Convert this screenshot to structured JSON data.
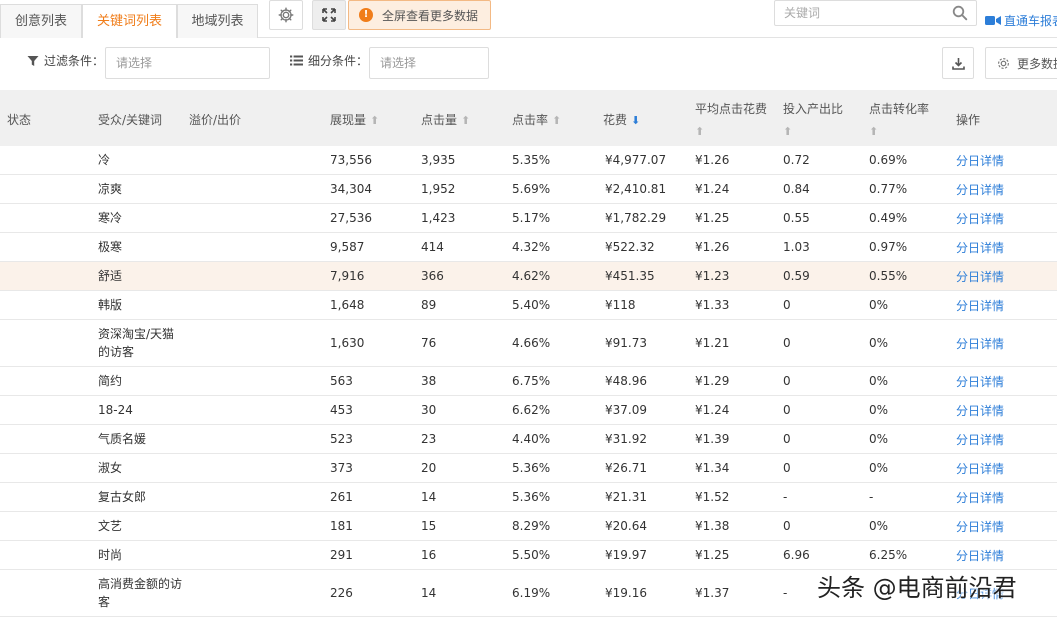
{
  "tabs": [
    {
      "label": "创意列表",
      "active": false
    },
    {
      "label": "关键词列表",
      "active": true
    },
    {
      "label": "地域列表",
      "active": false
    }
  ],
  "toolbar": {
    "settings_icon": "gear-icon",
    "fullscreen_icon": "expand-icon",
    "notice_label": "全屏查看更多数据",
    "search_placeholder": "关键词",
    "report_link": "直通车报表"
  },
  "filters": {
    "filter_label": "过滤条件：",
    "filter_placeholder": "请选择",
    "sub_label": "细分条件：",
    "sub_placeholder": "请选择",
    "more_label": "更多数据"
  },
  "table": {
    "headers": {
      "status": "状态",
      "keyword": "受众/关键词",
      "bid": "溢价/出价",
      "impressions": "展现量",
      "clicks": "点击量",
      "ctr": "点击率",
      "cost": "花费",
      "cpc": "平均点击花费",
      "roi": "投入产出比",
      "cvr": "点击转化率",
      "action": "操作"
    },
    "sorted_column": "花费",
    "rows": [
      {
        "keyword": "冷",
        "impressions": "73,556",
        "clicks": "3,935",
        "ctr": "5.35%",
        "cost": "¥4,977.07",
        "cpc": "¥1.26",
        "roi": "0.72",
        "cvr": "0.69%",
        "action": "分日详情"
      },
      {
        "keyword": "凉爽",
        "impressions": "34,304",
        "clicks": "1,952",
        "ctr": "5.69%",
        "cost": "¥2,410.81",
        "cpc": "¥1.24",
        "roi": "0.84",
        "cvr": "0.77%",
        "action": "分日详情"
      },
      {
        "keyword": "寒冷",
        "impressions": "27,536",
        "clicks": "1,423",
        "ctr": "5.17%",
        "cost": "¥1,782.29",
        "cpc": "¥1.25",
        "roi": "0.55",
        "cvr": "0.49%",
        "action": "分日详情"
      },
      {
        "keyword": "极寒",
        "impressions": "9,587",
        "clicks": "414",
        "ctr": "4.32%",
        "cost": "¥522.32",
        "cpc": "¥1.26",
        "roi": "1.03",
        "cvr": "0.97%",
        "action": "分日详情"
      },
      {
        "keyword": "舒适",
        "impressions": "7,916",
        "clicks": "366",
        "ctr": "4.62%",
        "cost": "¥451.35",
        "cpc": "¥1.23",
        "roi": "0.59",
        "cvr": "0.55%",
        "action": "分日详情"
      },
      {
        "keyword": "韩版",
        "impressions": "1,648",
        "clicks": "89",
        "ctr": "5.40%",
        "cost": "¥118",
        "cpc": "¥1.33",
        "roi": "0",
        "cvr": "0%",
        "action": "分日详情"
      },
      {
        "keyword": "资深淘宝/天猫的访客",
        "impressions": "1,630",
        "clicks": "76",
        "ctr": "4.66%",
        "cost": "¥91.73",
        "cpc": "¥1.21",
        "roi": "0",
        "cvr": "0%",
        "action": "分日详情"
      },
      {
        "keyword": "简约",
        "impressions": "563",
        "clicks": "38",
        "ctr": "6.75%",
        "cost": "¥48.96",
        "cpc": "¥1.29",
        "roi": "0",
        "cvr": "0%",
        "action": "分日详情"
      },
      {
        "keyword": "18-24",
        "impressions": "453",
        "clicks": "30",
        "ctr": "6.62%",
        "cost": "¥37.09",
        "cpc": "¥1.24",
        "roi": "0",
        "cvr": "0%",
        "action": "分日详情"
      },
      {
        "keyword": "气质名媛",
        "impressions": "523",
        "clicks": "23",
        "ctr": "4.40%",
        "cost": "¥31.92",
        "cpc": "¥1.39",
        "roi": "0",
        "cvr": "0%",
        "action": "分日详情"
      },
      {
        "keyword": "淑女",
        "impressions": "373",
        "clicks": "20",
        "ctr": "5.36%",
        "cost": "¥26.71",
        "cpc": "¥1.34",
        "roi": "0",
        "cvr": "0%",
        "action": "分日详情"
      },
      {
        "keyword": "复古女郎",
        "impressions": "261",
        "clicks": "14",
        "ctr": "5.36%",
        "cost": "¥21.31",
        "cpc": "¥1.52",
        "roi": "-",
        "cvr": "-",
        "action": "分日详情"
      },
      {
        "keyword": "文艺",
        "impressions": "181",
        "clicks": "15",
        "ctr": "8.29%",
        "cost": "¥20.64",
        "cpc": "¥1.38",
        "roi": "0",
        "cvr": "0%",
        "action": "分日详情"
      },
      {
        "keyword": "时尚",
        "impressions": "291",
        "clicks": "16",
        "ctr": "5.50%",
        "cost": "¥19.97",
        "cpc": "¥1.25",
        "roi": "6.96",
        "cvr": "6.25%",
        "action": "分日详情"
      },
      {
        "keyword": "高消费金额的访客",
        "impressions": "226",
        "clicks": "14",
        "ctr": "6.19%",
        "cost": "¥19.16",
        "cpc": "¥1.37",
        "roi": "-",
        "cvr": "",
        "action": "分日详情"
      }
    ]
  },
  "watermark": "头条 @电商前沿君",
  "colors": {
    "accent_orange": "#f07d1a",
    "link_blue": "#2d7ed8",
    "header_bg": "#f0f0f0",
    "highlight_row": "#fbf2ea"
  }
}
